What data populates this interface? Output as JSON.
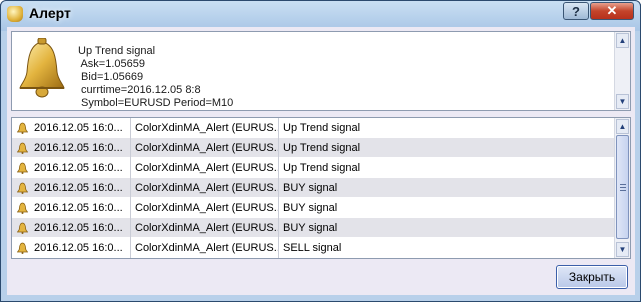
{
  "window": {
    "title": "Алерт",
    "help_label": "?",
    "close_glyph": "✕"
  },
  "message": {
    "text": "Up Trend signal\n Ask=1.05659\n Bid=1.05669\n currtime=2016.12.05 8:8\n Symbol=EURUSD Period=M10"
  },
  "alerts": [
    {
      "time": "2016.12.05 16:0...",
      "expert": "ColorXdinMA_Alert (EURUS...",
      "message": "Up Trend signal"
    },
    {
      "time": "2016.12.05 16:0...",
      "expert": "ColorXdinMA_Alert (EURUS...",
      "message": "Up Trend signal"
    },
    {
      "time": "2016.12.05 16:0...",
      "expert": "ColorXdinMA_Alert (EURUS...",
      "message": "Up Trend signal"
    },
    {
      "time": "2016.12.05 16:0...",
      "expert": "ColorXdinMA_Alert (EURUS...",
      "message": "BUY signal"
    },
    {
      "time": "2016.12.05 16:0...",
      "expert": "ColorXdinMA_Alert (EURUS...",
      "message": "BUY signal"
    },
    {
      "time": "2016.12.05 16:0...",
      "expert": "ColorXdinMA_Alert (EURUS...",
      "message": "BUY signal"
    },
    {
      "time": "2016.12.05 16:0...",
      "expert": "ColorXdinMA_Alert (EURUS...",
      "message": "SELL signal"
    }
  ],
  "actions": {
    "close_label": "Закрыть"
  },
  "icons": {
    "title": "bell-icon",
    "message": "bell-icon",
    "row": "bell-icon",
    "scroll_up": "arrow-up-icon",
    "scroll_down": "arrow-down-icon"
  },
  "colors": {
    "accent": "#3b5fa9",
    "close_red": "#c4442b",
    "row_alt": "#e3e3e9"
  }
}
